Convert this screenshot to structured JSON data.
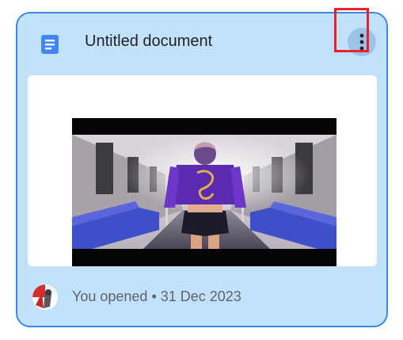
{
  "card": {
    "title": "Untitled document",
    "doc_icon": "google-docs-icon",
    "menu_icon": "more-vert-icon",
    "status_text": "You opened • 31 Dec 2023",
    "avatar_icon": "user-avatar",
    "preview_image": "video-thumbnail-subway-scene"
  },
  "colors": {
    "card_background": "#c2e2fb",
    "card_border": "#3b86e6",
    "doc_icon_blue": "#4285f4",
    "highlight_red": "#e8222b",
    "title_text": "#202124",
    "status_text": "#5f6368"
  }
}
